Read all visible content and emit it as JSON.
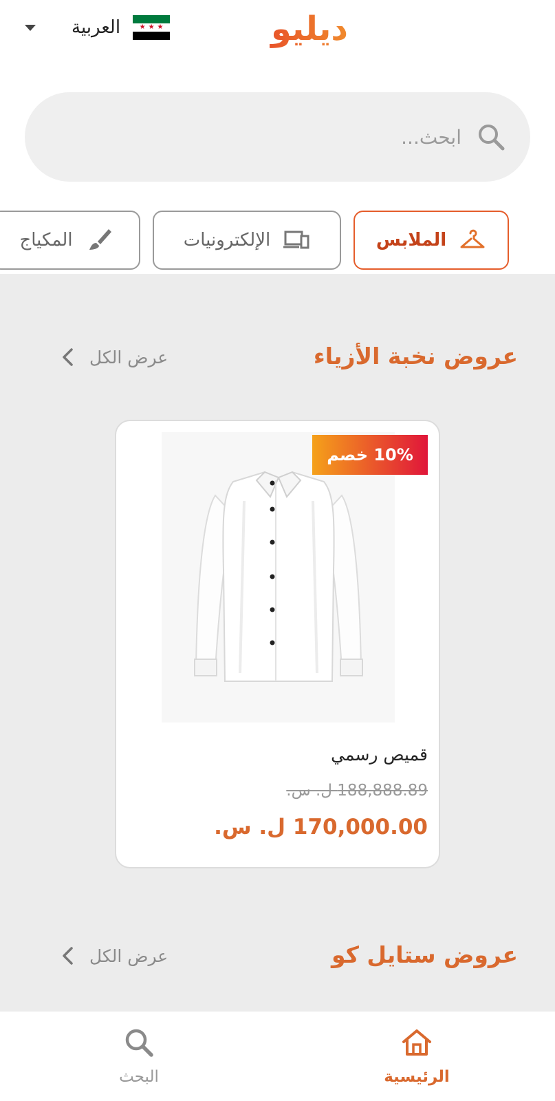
{
  "header": {
    "logo_text": "ديليو",
    "language_label": "العربية",
    "flag": "syria-flag-icon"
  },
  "search": {
    "placeholder": "ابحث...",
    "icon": "search-icon"
  },
  "categories": [
    {
      "label": "الملابس",
      "icon": "hanger-icon",
      "active": true
    },
    {
      "label": "الإلكترونيات",
      "icon": "devices-icon",
      "active": false
    },
    {
      "label": "المكياج",
      "icon": "brush-icon",
      "active": false
    }
  ],
  "sections": [
    {
      "title": "عروض نخبة الأزياء",
      "view_all": "عرض الكل"
    },
    {
      "title": "عروض ستايل كو",
      "view_all": "عرض الكل"
    }
  ],
  "product": {
    "discount_badge": "10% خصم",
    "name": "قميص رسمي",
    "old_price": "188,888.89 ل. س.",
    "new_price": "170,000.00 ل. س."
  },
  "bottom_nav": {
    "home_label": "الرئيسية",
    "search_label": "البحث"
  },
  "colors": {
    "brand": "#d9692e",
    "badge_start": "#f5a11a",
    "badge_end": "#e0163a",
    "background": "#ececec"
  }
}
